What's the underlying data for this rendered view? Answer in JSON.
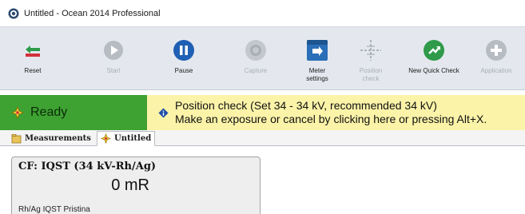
{
  "window": {
    "title": "Untitled - Ocean 2014 Professional"
  },
  "toolbar": {
    "buttons": [
      {
        "label": "Reset",
        "icon": "reset-icon",
        "enabled": true
      },
      {
        "label": "Start",
        "icon": "play-icon",
        "enabled": false
      },
      {
        "label": "Pause",
        "icon": "pause-icon",
        "enabled": true
      },
      {
        "label": "Capture",
        "icon": "capture-icon",
        "enabled": false
      },
      {
        "label": "Meter\nsettings",
        "icon": "meter-settings-icon",
        "enabled": true
      },
      {
        "label": "Position\ncheck",
        "icon": "crosshair-icon",
        "enabled": false
      },
      {
        "label": "New Quick Check",
        "icon": "new-quick-check-icon",
        "enabled": true
      },
      {
        "label": "Application",
        "icon": "add-icon",
        "enabled": false
      }
    ]
  },
  "status": {
    "ready": "Ready",
    "message": "Position check (Set 34 - 34 kV, recommended 34 kV)\nMake an exposure or cancel by clicking here or pressing Alt+X."
  },
  "tabs": [
    {
      "label": "Measurements",
      "icon": "measurements-icon"
    },
    {
      "label": "Untitled",
      "icon": "sparkle-icon",
      "active": true
    }
  ],
  "measurement_card": {
    "title": "CF: IQST (34 kV-Rh/Ag)",
    "value": "0 mR",
    "subtitle": "Rh/Ag IQST Pristina"
  },
  "colors": {
    "toolbar_bg": "#e4e8ee",
    "ready_green": "#3ea232",
    "message_yellow": "#fbf3a8",
    "pause_blue": "#1f5fb4",
    "quick_check_green": "#2e9a4a"
  }
}
